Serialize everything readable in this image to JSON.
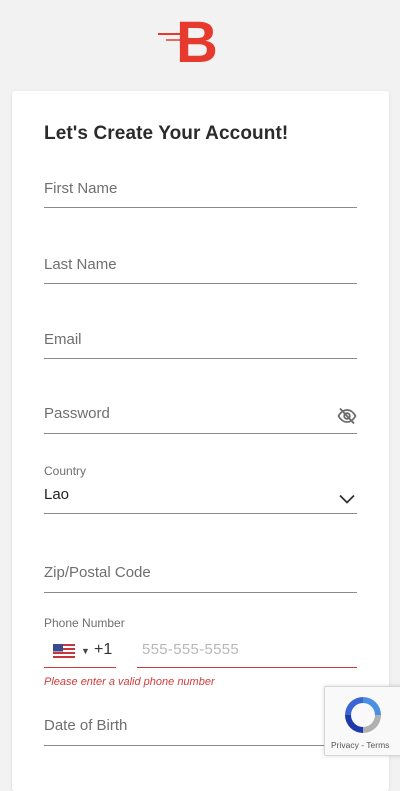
{
  "brand": {
    "logo_letter": "B",
    "accent": "#e63a2e"
  },
  "form": {
    "title": "Let's Create Your Account!",
    "first_name": {
      "placeholder": "First Name"
    },
    "last_name": {
      "placeholder": "Last Name"
    },
    "email": {
      "placeholder": "Email"
    },
    "password": {
      "placeholder": "Password",
      "toggle_icon": "eye-off-icon"
    },
    "country": {
      "label": "Country",
      "value": "Lao",
      "icon": "chevron-down-icon"
    },
    "zip": {
      "placeholder": "Zip/Postal Code"
    },
    "phone": {
      "label": "Phone Number",
      "flag_icon": "us-flag-icon",
      "dial_code": "+1",
      "placeholder": "555-555-5555",
      "error": "Please enter a valid phone number",
      "error_color": "#d23c3c"
    },
    "dob": {
      "placeholder": "Date of Birth"
    }
  },
  "recaptcha": {
    "links": "Privacy - Terms"
  }
}
